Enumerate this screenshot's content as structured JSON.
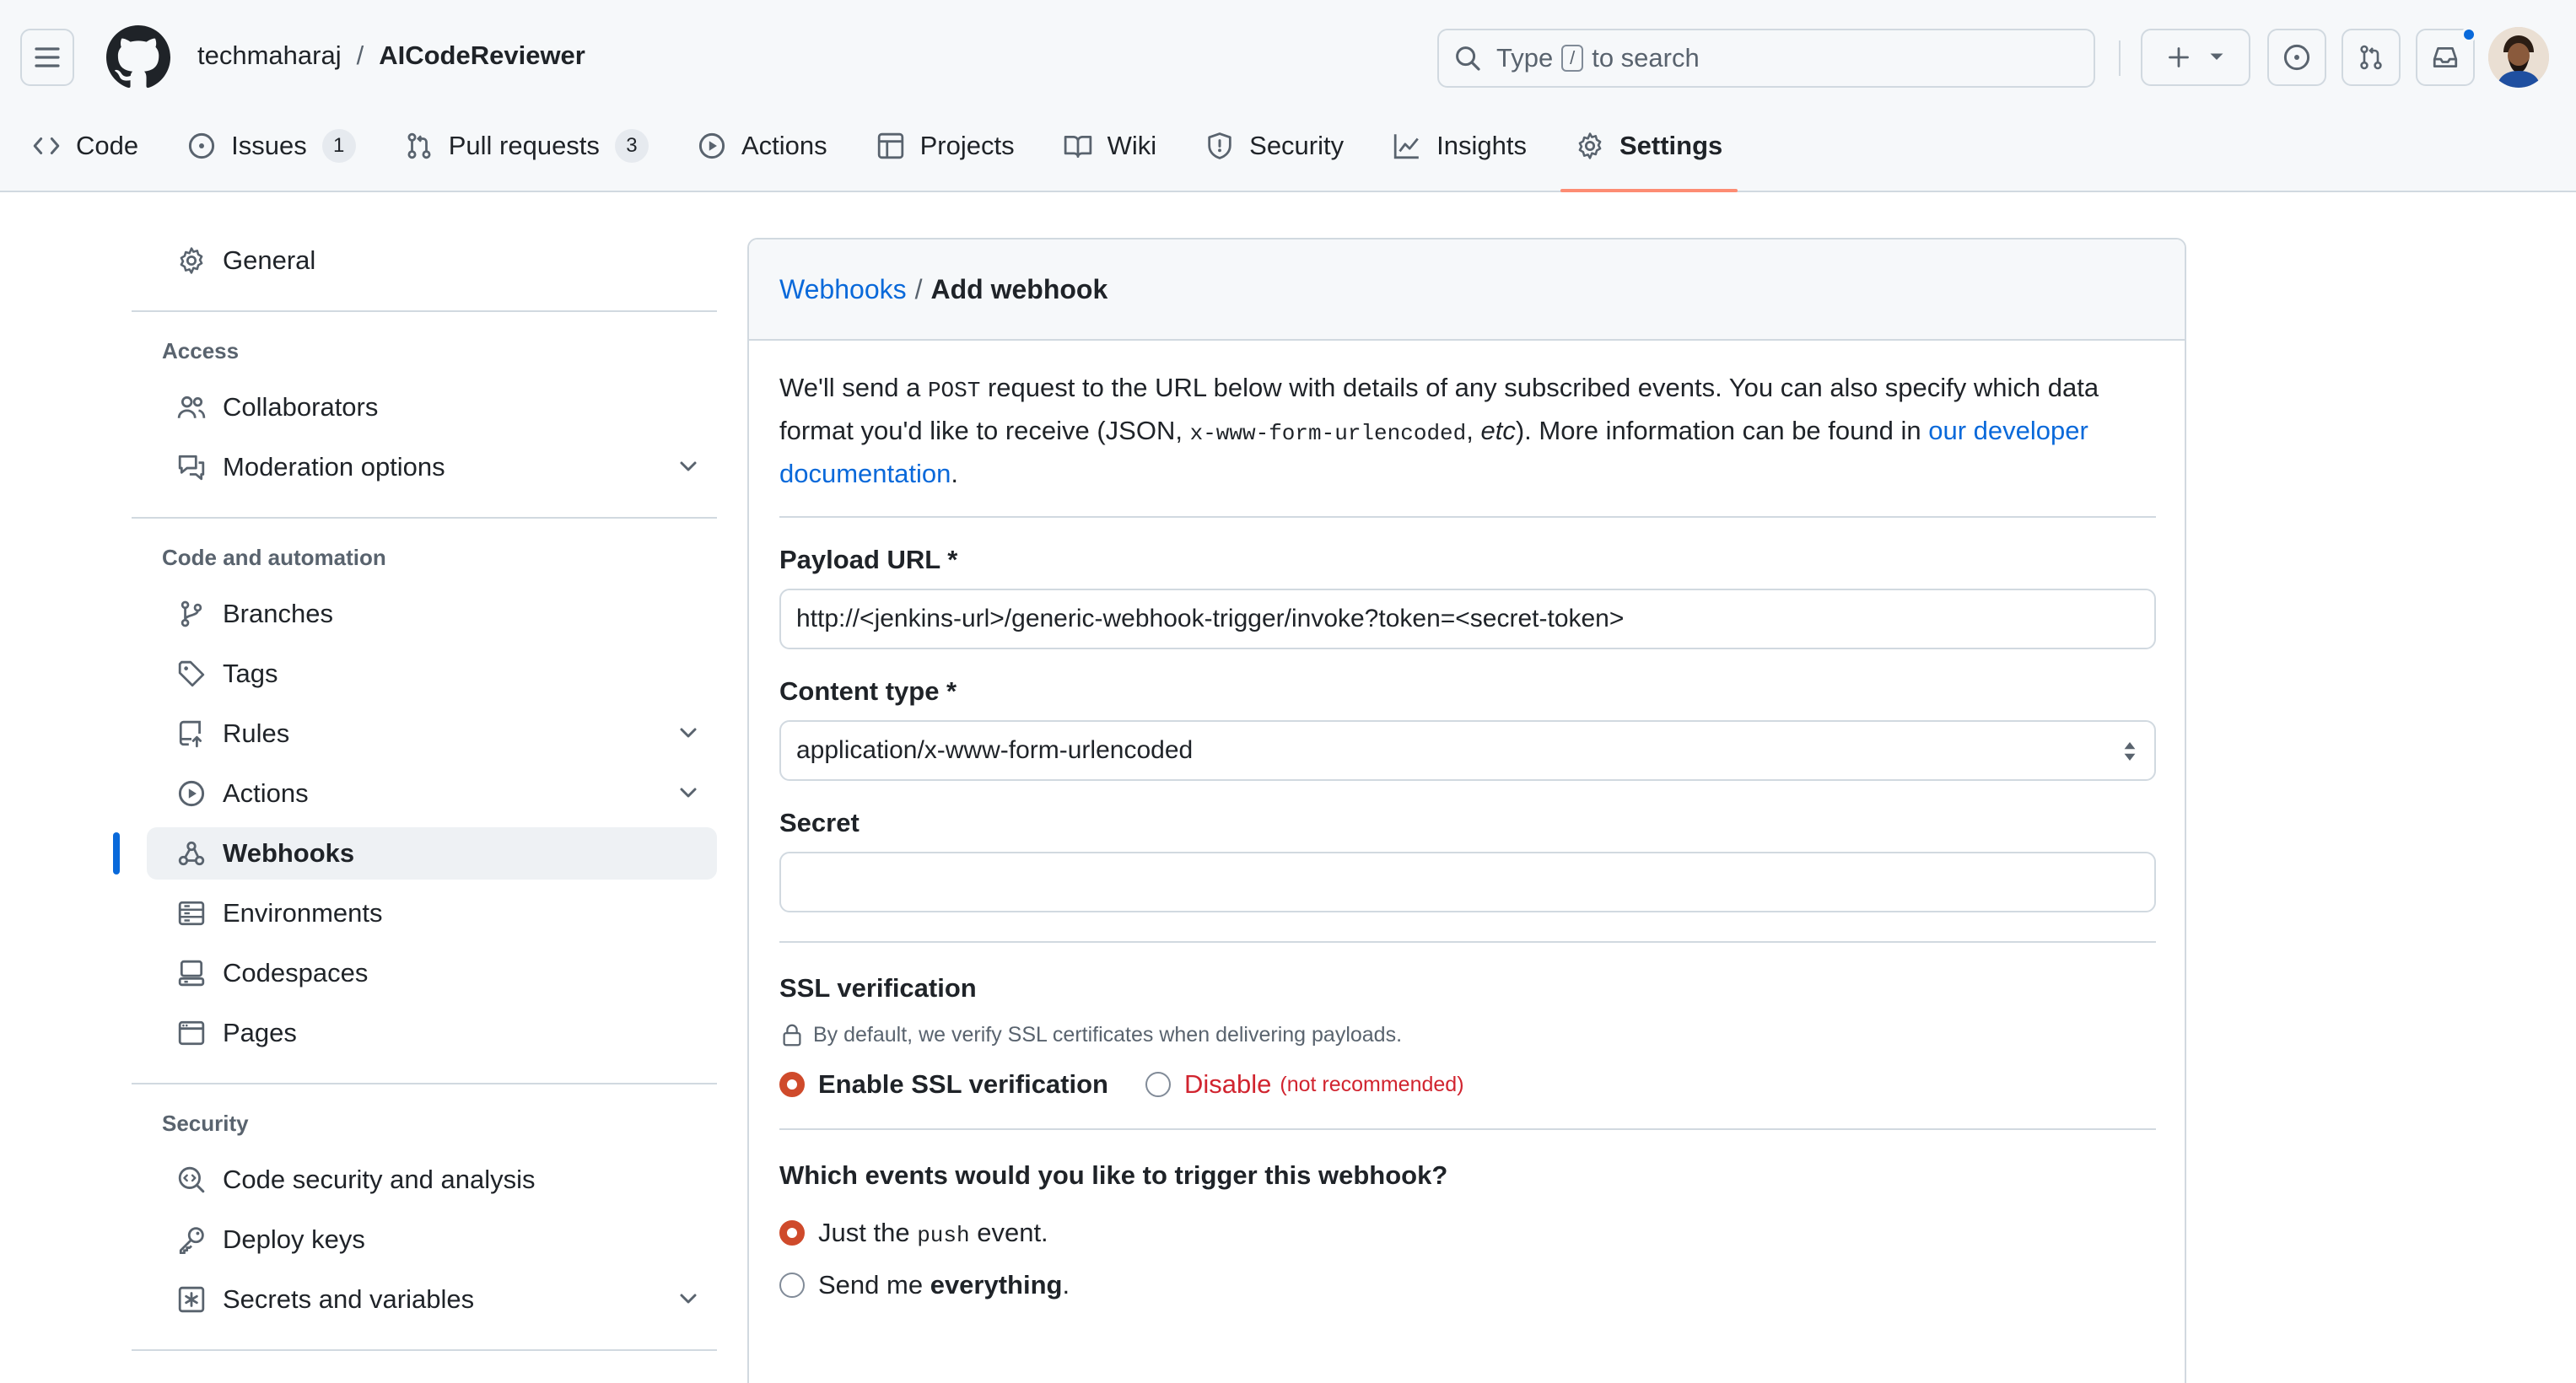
{
  "header": {
    "owner": "techmaharaj",
    "separator": "/",
    "repo": "AICodeReviewer",
    "search": {
      "before": "Type",
      "key": "/",
      "after": "to search"
    }
  },
  "tabs": [
    {
      "label": "Code",
      "icon": "code-icon"
    },
    {
      "label": "Issues",
      "count": "1",
      "icon": "issue-icon"
    },
    {
      "label": "Pull requests",
      "count": "3",
      "icon": "pull-request-icon"
    },
    {
      "label": "Actions",
      "icon": "play-icon"
    },
    {
      "label": "Projects",
      "icon": "table-icon"
    },
    {
      "label": "Wiki",
      "icon": "book-icon"
    },
    {
      "label": "Security",
      "icon": "shield-icon"
    },
    {
      "label": "Insights",
      "icon": "graph-icon"
    },
    {
      "label": "Settings",
      "icon": "gear-icon",
      "active": true
    }
  ],
  "sidebar": {
    "general": "General",
    "groups": {
      "access": "Access",
      "code_automation": "Code and automation",
      "security": "Security"
    },
    "items": {
      "collaborators": "Collaborators",
      "moderation": "Moderation options",
      "branches": "Branches",
      "tags": "Tags",
      "rules": "Rules",
      "actions": "Actions",
      "webhooks": "Webhooks",
      "environments": "Environments",
      "codespaces": "Codespaces",
      "pages": "Pages",
      "code_security": "Code security and analysis",
      "deploy_keys": "Deploy keys",
      "secrets": "Secrets and variables"
    }
  },
  "main": {
    "breadcrumb_link": "Webhooks",
    "breadcrumb_sep": "/",
    "breadcrumb_current": "Add webhook",
    "intro": {
      "p1": "We'll send a ",
      "code1": "POST",
      "p2": " request to the URL below with details of any subscribed events. You can also specify which data format you'd like to receive (JSON, ",
      "code2": "x-www-form-urlencoded",
      "p3": ", ",
      "etc": "etc",
      "p4": "). More information can be found in ",
      "link": "our developer documentation",
      "p5": "."
    },
    "payload_label": "Payload URL *",
    "payload_value": "http://<jenkins-url>/generic-webhook-trigger/invoke?token=<secret-token>",
    "content_type_label": "Content type *",
    "content_type_value": "application/x-www-form-urlencoded",
    "secret_label": "Secret",
    "secret_value": "",
    "ssl": {
      "title": "SSL verification",
      "note": "By default, we verify SSL certificates when delivering payloads.",
      "enable": "Enable SSL verification",
      "disable": "Disable",
      "disable_note": "(not recommended)"
    },
    "events": {
      "question": "Which events would you like to trigger this webhook?",
      "just_pre": "Just the ",
      "just_code": "push",
      "just_post": " event.",
      "everything_pre": "Send me ",
      "everything_bold": "everything",
      "everything_post": "."
    }
  },
  "colors": {
    "accent": "#0969da",
    "active_tab_underline": "#fd8c73",
    "radio_checked": "#cf4a2b",
    "danger": "#d1242f"
  }
}
